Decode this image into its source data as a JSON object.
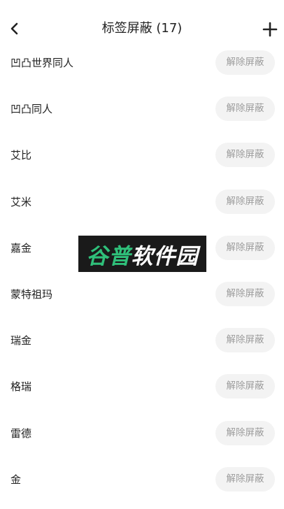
{
  "header": {
    "back_icon": "chevron-left-icon",
    "title": "标签屏蔽 (17)",
    "add_icon": "plus-icon"
  },
  "tags": [
    {
      "label": "凹凸世界同人",
      "button": "解除屏蔽"
    },
    {
      "label": "凹凸同人",
      "button": "解除屏蔽"
    },
    {
      "label": "艾比",
      "button": "解除屏蔽"
    },
    {
      "label": "艾米",
      "button": "解除屏蔽"
    },
    {
      "label": "嘉金",
      "button": "解除屏蔽"
    },
    {
      "label": "蒙特祖玛",
      "button": "解除屏蔽"
    },
    {
      "label": "瑞金",
      "button": "解除屏蔽"
    },
    {
      "label": "格瑞",
      "button": "解除屏蔽"
    },
    {
      "label": "雷德",
      "button": "解除屏蔽"
    },
    {
      "label": "金",
      "button": "解除屏蔽"
    }
  ],
  "watermark": {
    "green_text": "谷普",
    "white_text": "软件园"
  },
  "colors": {
    "button_bg": "#f3f3f3",
    "button_text": "#9d9d9d",
    "watermark_bg": "#1a1a1a",
    "watermark_green": "#2fc07a"
  }
}
